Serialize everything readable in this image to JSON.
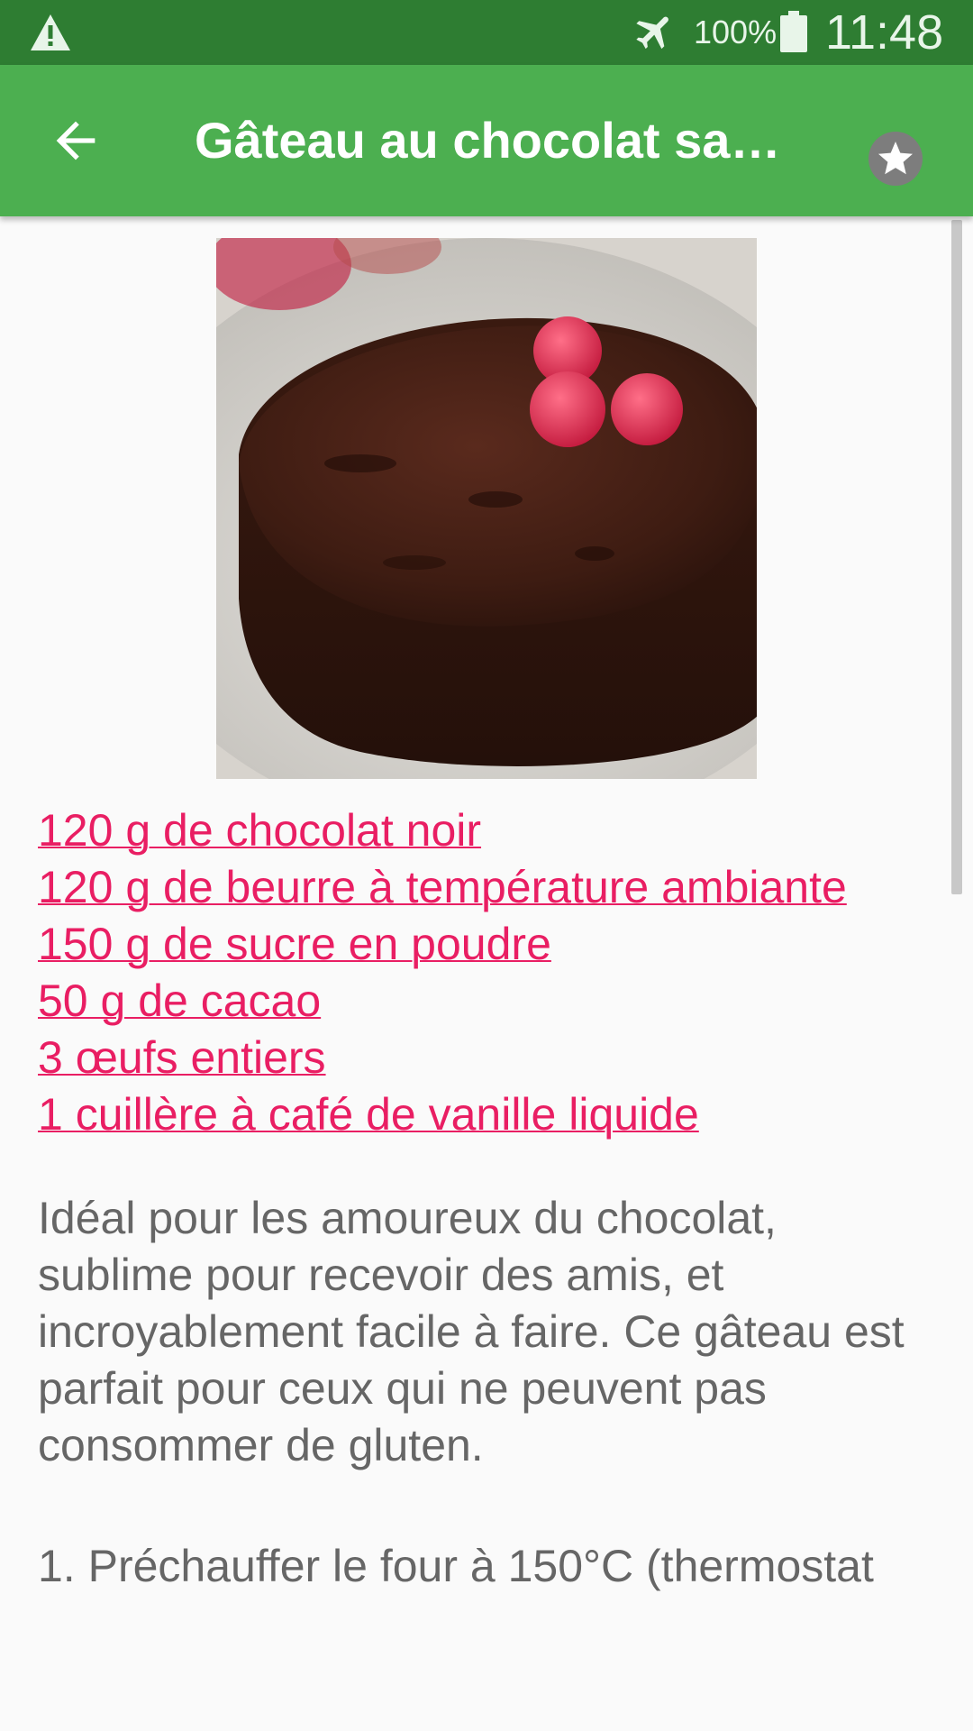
{
  "status_bar": {
    "battery_percent": "100%",
    "time": "11:48",
    "icons": [
      "warning-icon",
      "airplane-mode-icon",
      "battery-icon"
    ]
  },
  "app_bar": {
    "title": "Gâteau au chocolat san…",
    "back_icon": "arrow-left-icon",
    "favorite_icon": "star-icon"
  },
  "recipe": {
    "ingredients": [
      "120 g de chocolat noir",
      "120 g de beurre à température ambiante",
      "150 g de sucre en poudre",
      "50 g de cacao",
      "3 œufs entiers",
      "1 cuillère à café de vanille liquide"
    ],
    "description": "Idéal pour les amoureux du chocolat, sublime pour recevoir des amis, et incroyablement facile à faire. Ce gâteau est parfait pour ceux qui ne peuvent pas consommer de gluten.",
    "first_step": "1. Préchauffer le four à 150°C (thermostat"
  },
  "colors": {
    "status_bar": "#2e7d32",
    "app_bar": "#4caf50",
    "link": "#e91e63",
    "body_text": "#666666",
    "background": "#fafafa"
  }
}
